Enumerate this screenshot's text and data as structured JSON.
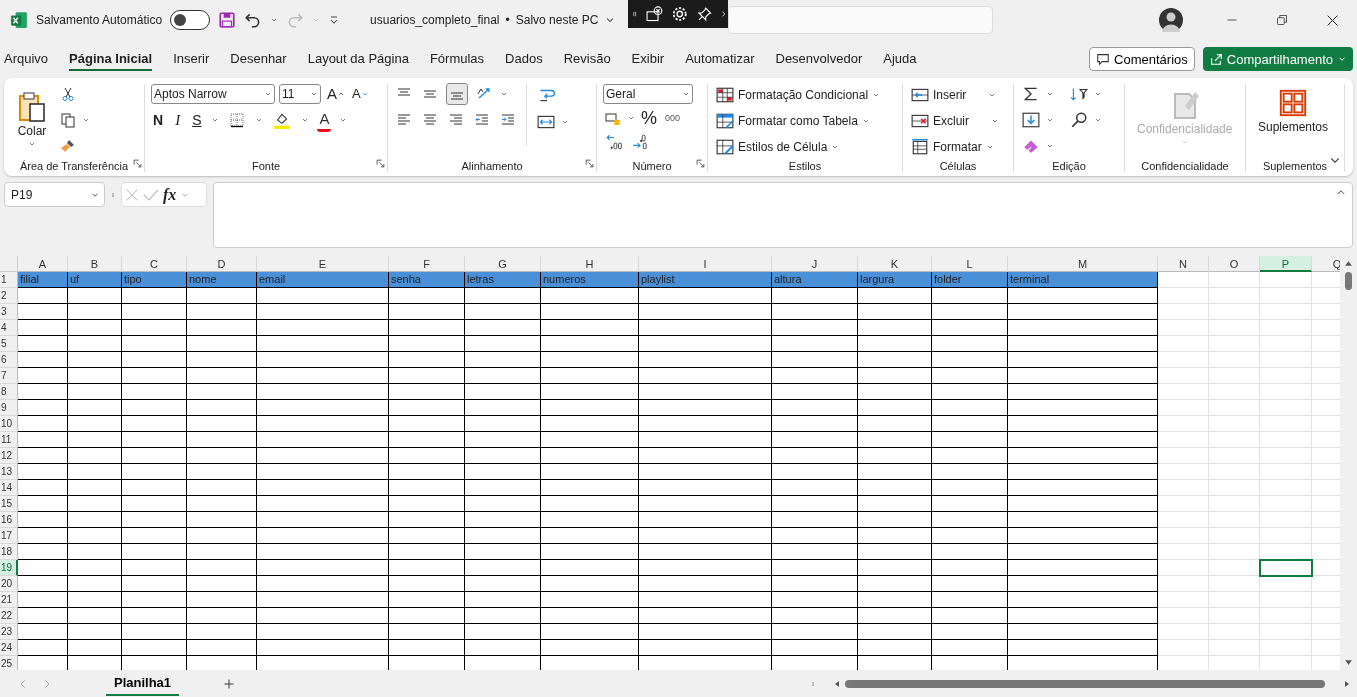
{
  "title_bar": {
    "autosave_label": "Salvamento Automático",
    "autosave_on": false,
    "file_name": "usuarios_completo_final",
    "separator": "•",
    "save_status": "Salvo neste PC"
  },
  "menu_tabs": [
    {
      "label": "Arquivo",
      "selected": false
    },
    {
      "label": "Página Inicial",
      "selected": true
    },
    {
      "label": "Inserir",
      "selected": false
    },
    {
      "label": "Desenhar",
      "selected": false
    },
    {
      "label": "Layout da Página",
      "selected": false
    },
    {
      "label": "Fórmulas",
      "selected": false
    },
    {
      "label": "Dados",
      "selected": false
    },
    {
      "label": "Revisão",
      "selected": false
    },
    {
      "label": "Exibir",
      "selected": false
    },
    {
      "label": "Automatizar",
      "selected": false
    },
    {
      "label": "Desenvolvedor",
      "selected": false
    },
    {
      "label": "Ajuda",
      "selected": false
    }
  ],
  "comments_button": "Comentários",
  "share_button": "Compartilhamento",
  "ribbon_groups": [
    {
      "kind": "clipboard",
      "label": "Área de Transferência",
      "paste": "Colar",
      "launcher": true
    },
    {
      "kind": "font",
      "label": "Fonte",
      "font": "Aptos Narrow",
      "size": "11",
      "grow": "A",
      "shrink": "A",
      "bold": "N",
      "italic": "I",
      "underline": "S",
      "font_color": "A",
      "launcher": true
    },
    {
      "kind": "alignment",
      "label": "Alinhamento",
      "vertical": [
        {
          "selected": false
        },
        {
          "selected": false
        },
        {
          "selected": true
        }
      ],
      "launcher": true
    },
    {
      "kind": "number",
      "label": "Número",
      "format": "Geral",
      "percent": "%",
      "thousands": "000",
      "launcher": true
    },
    {
      "kind": "styles",
      "label": "Estilos",
      "items": [
        "Formatação Condicional",
        "Formatar como Tabela",
        "Estilos de Célula"
      ]
    },
    {
      "kind": "cells",
      "label": "Células",
      "items": [
        "Inserir",
        "Excluir",
        "Formatar"
      ]
    },
    {
      "kind": "editing",
      "label": "Edição"
    },
    {
      "kind": "sensitivity",
      "label": "Confidencialidade",
      "button": "Confidencialidade",
      "disabled": true
    },
    {
      "kind": "addins",
      "label": "Suplementos",
      "button": "Suplementos"
    }
  ],
  "formula_bar": {
    "name_box": "P19",
    "function_label": "fx"
  },
  "sheet": {
    "columns": [
      {
        "letter": "A",
        "heading": "filial",
        "selected": false
      },
      {
        "letter": "B",
        "heading": "uf",
        "selected": false
      },
      {
        "letter": "C",
        "heading": "tipo",
        "selected": false
      },
      {
        "letter": "D",
        "heading": "nome",
        "selected": false
      },
      {
        "letter": "E",
        "heading": "email",
        "selected": false
      },
      {
        "letter": "F",
        "heading": "senha",
        "selected": false
      },
      {
        "letter": "G",
        "heading": "letras",
        "selected": false
      },
      {
        "letter": "H",
        "heading": "numeros",
        "selected": false
      },
      {
        "letter": "I",
        "heading": "playlist",
        "selected": false
      },
      {
        "letter": "J",
        "heading": "altura",
        "selected": false
      },
      {
        "letter": "K",
        "heading": "largura",
        "selected": false
      },
      {
        "letter": "L",
        "heading": "folder",
        "selected": false
      },
      {
        "letter": "M",
        "heading": "terminal",
        "selected": false
      },
      {
        "letter": "N",
        "selected": false
      },
      {
        "letter": "O",
        "selected": false
      },
      {
        "letter": "P",
        "selected": true
      },
      {
        "letter": "Q",
        "selected": false
      }
    ],
    "rows": [
      {
        "number": "1",
        "selected": false
      },
      {
        "number": "2",
        "selected": false
      },
      {
        "number": "3",
        "selected": false
      },
      {
        "number": "4",
        "selected": false
      },
      {
        "number": "5",
        "selected": false
      },
      {
        "number": "6",
        "selected": false
      },
      {
        "number": "7",
        "selected": false
      },
      {
        "number": "8",
        "selected": false
      },
      {
        "number": "9",
        "selected": false
      },
      {
        "number": "10",
        "selected": false
      },
      {
        "number": "11",
        "selected": false
      },
      {
        "number": "12",
        "selected": false
      },
      {
        "number": "13",
        "selected": false
      },
      {
        "number": "14",
        "selected": false
      },
      {
        "number": "15",
        "selected": false
      },
      {
        "number": "16",
        "selected": false
      },
      {
        "number": "17",
        "selected": false
      },
      {
        "number": "18",
        "selected": false
      },
      {
        "number": "19",
        "selected": true
      },
      {
        "number": "20",
        "selected": false
      },
      {
        "number": "21",
        "selected": false
      },
      {
        "number": "22",
        "selected": false
      },
      {
        "number": "23",
        "selected": false
      },
      {
        "number": "24",
        "selected": false
      },
      {
        "number": "25",
        "selected": false
      }
    ]
  },
  "sheet_tabs": [
    {
      "label": "Planilha1",
      "selected": true
    }
  ]
}
